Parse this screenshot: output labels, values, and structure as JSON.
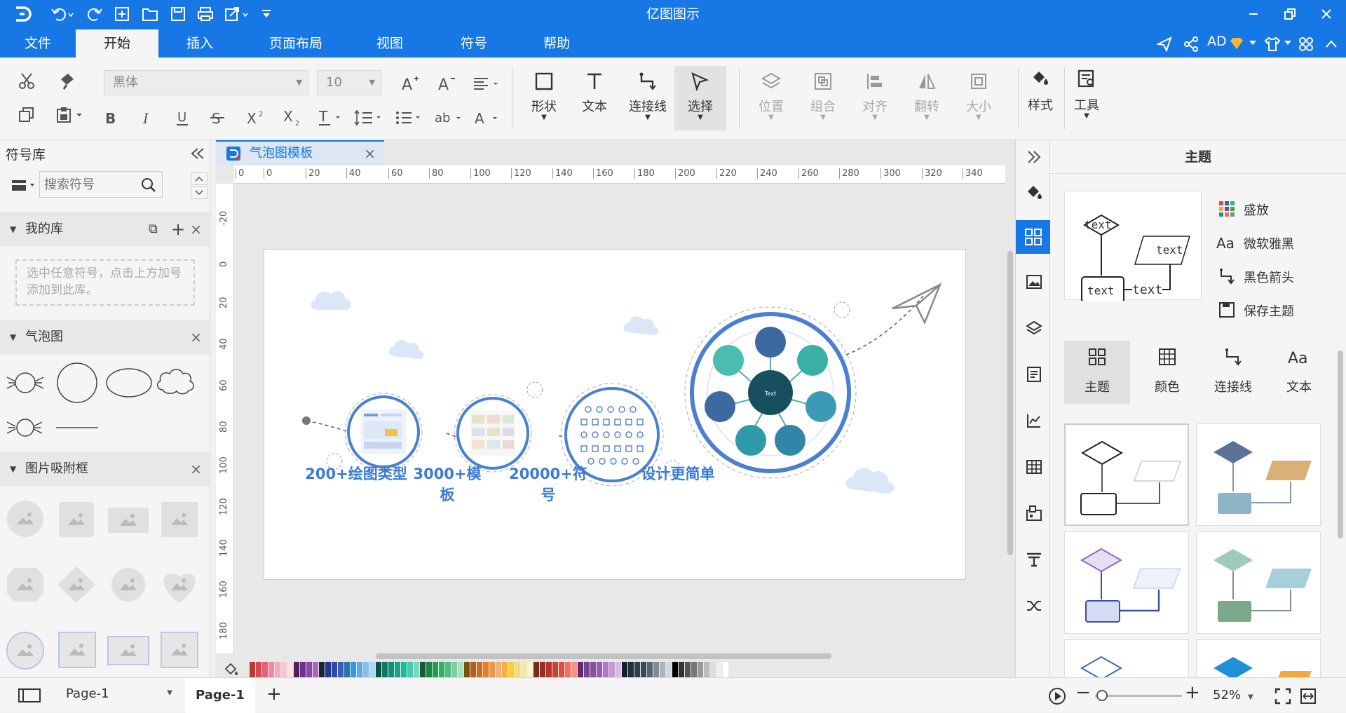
{
  "app": {
    "title": "亿图图示",
    "user": "AD"
  },
  "menu_tabs": [
    "文件",
    "开始",
    "插入",
    "页面布局",
    "视图",
    "符号",
    "帮助"
  ],
  "ribbon": {
    "font_family": "黑体",
    "font_size": "10",
    "tools": [
      "形状",
      "文本",
      "连接线",
      "选择"
    ],
    "arrange": [
      "位置",
      "组合",
      "对齐",
      "翻转",
      "大小"
    ],
    "style_label": "样式",
    "tools_label": "工具"
  },
  "library": {
    "title": "符号库",
    "search_placeholder": "搜索符号",
    "my_library": "我的库",
    "my_library_hint": "选中任意符号，点击上方加号添加到此库。",
    "bubble_section": "气泡图",
    "image_frame_section": "图片吸附框"
  },
  "document": {
    "tab_name": "气泡图模板"
  },
  "ruler": {
    "h": [
      "0",
      "0",
      "20",
      "40",
      "60",
      "80",
      "100",
      "120",
      "140",
      "160",
      "180",
      "200",
      "220",
      "240",
      "260",
      "280",
      "300",
      "320",
      "340"
    ],
    "v": [
      "-20",
      "0",
      "20",
      "40",
      "60",
      "80",
      "100",
      "120",
      "140",
      "160",
      "180"
    ]
  },
  "canvas": {
    "captions": [
      "200+绘图类型",
      "3000+模板",
      "20000+符号",
      "设计更简单"
    ],
    "node_label": "Text"
  },
  "theme_panel": {
    "title": "主题",
    "preview_text": "text",
    "options": [
      "盛放",
      "微软雅黑",
      "黑色箭头",
      "保存主题"
    ],
    "tabs": [
      "主题",
      "颜色",
      "连接线",
      "文本"
    ]
  },
  "status": {
    "page_selector": "Page-1",
    "active_page": "Page-1",
    "zoom": "52%"
  },
  "colors": {
    "accent": "#1677e5",
    "bubble_blue": "#4a7fd1"
  }
}
